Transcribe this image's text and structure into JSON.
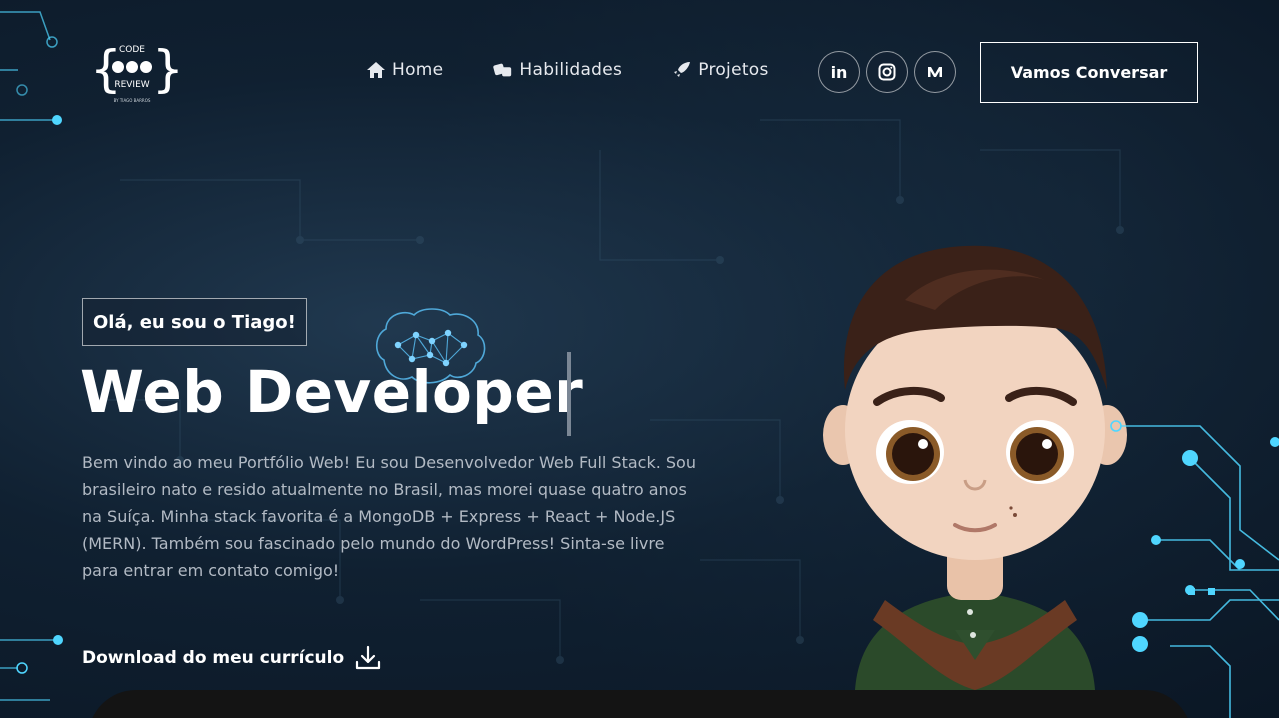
{
  "logo": {
    "line1": "CODE",
    "line2": "REVIEW",
    "byline": "BY TIAGO BARROS"
  },
  "nav": {
    "items": [
      {
        "label": "Home",
        "icon": "home-icon"
      },
      {
        "label": "Habilidades",
        "icon": "dice-icon"
      },
      {
        "label": "Projetos",
        "icon": "rocket-icon"
      }
    ],
    "socials": [
      {
        "label": "in",
        "icon": "linkedin-icon"
      },
      {
        "label": "",
        "icon": "instagram-icon"
      },
      {
        "label": "",
        "icon": "medium-icon"
      }
    ],
    "cta": "Vamos Conversar"
  },
  "hero": {
    "tagline": "Olá, eu sou o Tiago!",
    "title": "Web Developer",
    "intro": "Bem vindo ao meu Portfólio Web! Eu sou Desenvolvedor Web Full Stack. Sou brasileiro nato e resido atualmente no Brasil, mas morei quase quatro anos na Suíça. Minha stack favorita é a MongoDB + Express + React + Node.JS (MERN). Também sou fascinado pelo mundo do WordPress! Sinta-se livre para entrar em contato comigo!",
    "download": "Download do meu currículo"
  },
  "colors": {
    "background": "#0c1a29",
    "accent_cyan": "#4fd6ff",
    "text_muted": "#b2bac4",
    "panel": "#141414"
  }
}
